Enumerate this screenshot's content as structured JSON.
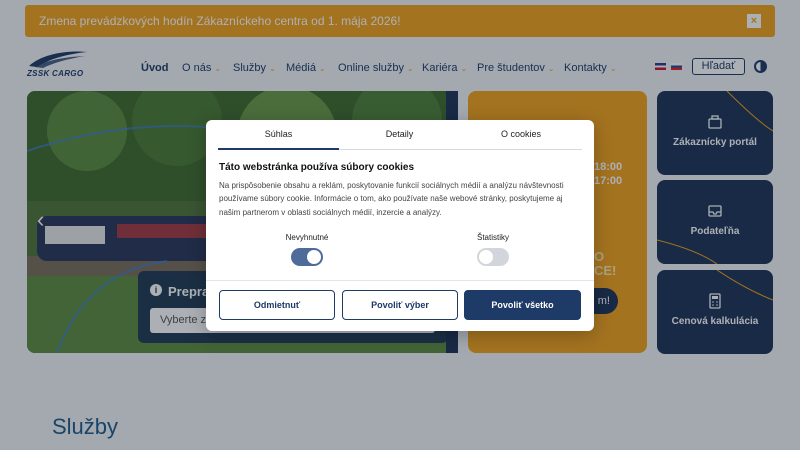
{
  "banner": {
    "text": "Zmena prevádzkových hodín Zákazníckeho centra od 1. mája 2026!",
    "close_icon": "×"
  },
  "logo": {
    "text": "ZSSK CARGO"
  },
  "nav": {
    "items": [
      {
        "label": "Úvod"
      },
      {
        "label": "O nás"
      },
      {
        "label": "Služby"
      },
      {
        "label": "Médiá"
      },
      {
        "label": "Online služby"
      },
      {
        "label": "Kariéra"
      },
      {
        "label": "Pre študentov"
      },
      {
        "label": "Kontakty"
      }
    ],
    "chevron": "⌄",
    "search_label": "Hľadať"
  },
  "hero": {
    "arrow_icon": "‹",
    "prep_title": "Prepra",
    "prep_info_icon": "i",
    "prep_placeholder": "Vyberte z r"
  },
  "orange_panel": {
    "time1": "18:00",
    "time2": "17:00",
    "big1": "O",
    "big2": "CE!",
    "button_label": "m!"
  },
  "tiles": [
    {
      "label": "Zákaznícky portál",
      "icon": "briefcase-icon"
    },
    {
      "label": "Podateľňa",
      "icon": "inbox-icon"
    },
    {
      "label": "Cenová kalkulácia",
      "icon": "calculator-icon"
    }
  ],
  "cookie_modal": {
    "tabs": [
      "Súhlas",
      "Detaily",
      "O cookies"
    ],
    "title": "Táto webstránka používa súbory cookies",
    "body": "Na prispôsobenie obsahu a reklám, poskytovanie funkcií sociálnych médií a analýzu návštevnosti používame súbory cookie. Informácie o tom, ako používate naše webové stránky, poskytujeme aj našim partnerom v oblasti sociálnych médií, inzercie a analýzy.",
    "toggles": [
      {
        "label": "Nevyhnutné",
        "on": true
      },
      {
        "label": "Štatistiky",
        "on": false
      }
    ],
    "buttons": [
      "Odmietnuť",
      "Povoliť výber",
      "Povoliť všetko"
    ]
  },
  "section": {
    "title": "Služby"
  },
  "colors": {
    "accent_orange": "#f3a21b",
    "navy": "#1e3a66",
    "tile_navy": "#1c3254"
  }
}
